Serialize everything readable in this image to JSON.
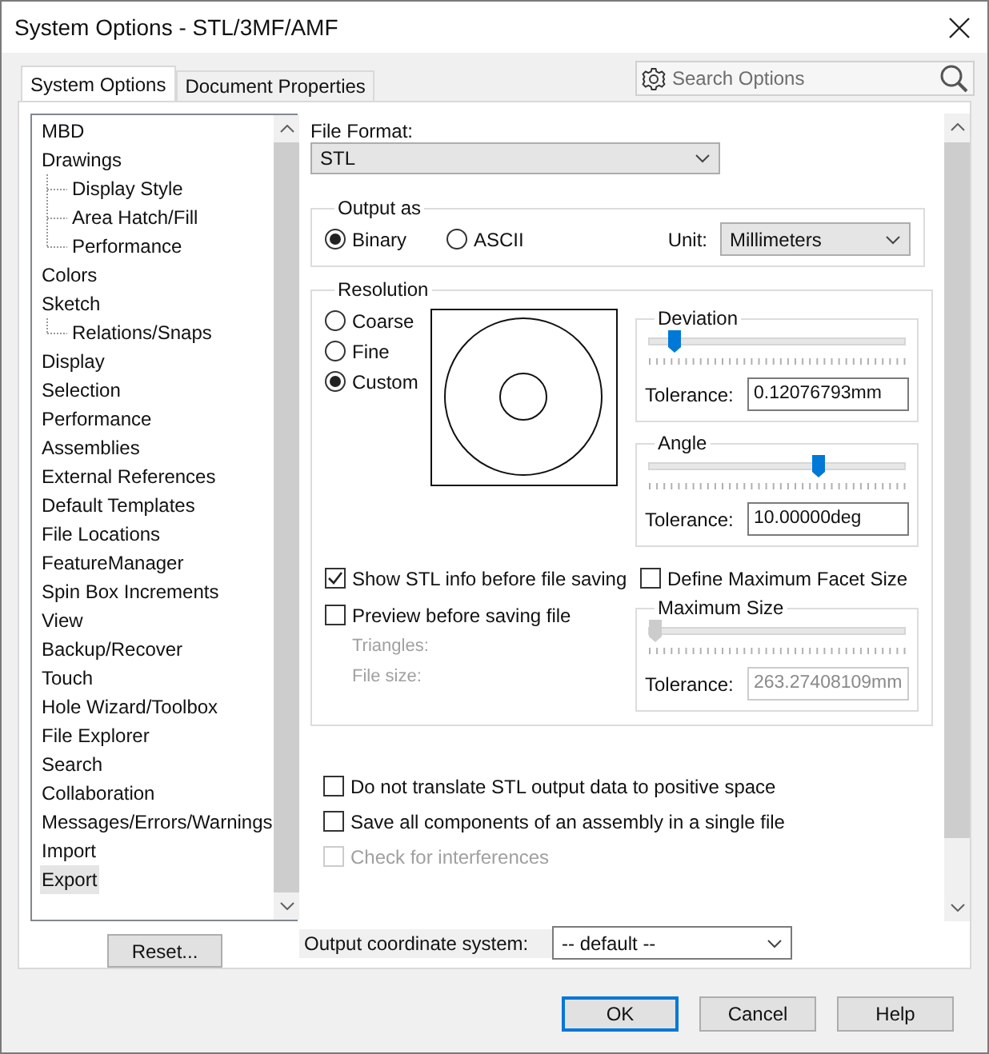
{
  "window": {
    "title": "System Options - STL/3MF/AMF"
  },
  "tabs": [
    {
      "label": "System Options",
      "selected": true
    },
    {
      "label": "Document Properties",
      "selected": false
    }
  ],
  "search": {
    "placeholder": "Search Options"
  },
  "tree": [
    {
      "label": "MBD",
      "selected": false
    },
    {
      "label": "Drawings",
      "selected": false,
      "children": [
        {
          "label": "Display Style",
          "selected": false
        },
        {
          "label": "Area Hatch/Fill",
          "selected": false
        },
        {
          "label": "Performance",
          "selected": false
        }
      ]
    },
    {
      "label": "Colors",
      "selected": false
    },
    {
      "label": "Sketch",
      "selected": false,
      "children": [
        {
          "label": "Relations/Snaps",
          "selected": false
        }
      ]
    },
    {
      "label": "Display",
      "selected": false
    },
    {
      "label": "Selection",
      "selected": false
    },
    {
      "label": "Performance",
      "selected": false
    },
    {
      "label": "Assemblies",
      "selected": false
    },
    {
      "label": "External References",
      "selected": false
    },
    {
      "label": "Default Templates",
      "selected": false
    },
    {
      "label": "File Locations",
      "selected": false
    },
    {
      "label": "FeatureManager",
      "selected": false
    },
    {
      "label": "Spin Box Increments",
      "selected": false
    },
    {
      "label": "View",
      "selected": false
    },
    {
      "label": "Backup/Recover",
      "selected": false
    },
    {
      "label": "Touch",
      "selected": false
    },
    {
      "label": "Hole Wizard/Toolbox",
      "selected": false
    },
    {
      "label": "File Explorer",
      "selected": false
    },
    {
      "label": "Search",
      "selected": false
    },
    {
      "label": "Collaboration",
      "selected": false
    },
    {
      "label": "Messages/Errors/Warnings",
      "selected": false
    },
    {
      "label": "Import",
      "selected": false
    },
    {
      "label": "Export",
      "selected": true
    }
  ],
  "reset_button": "Reset...",
  "file_format": {
    "label": "File Format:",
    "value": "STL"
  },
  "output_as": {
    "title": "Output as",
    "options": [
      {
        "label": "Binary",
        "selected": true
      },
      {
        "label": "ASCII",
        "selected": false
      }
    ],
    "unit_label": "Unit:",
    "unit": "Millimeters"
  },
  "resolution": {
    "title": "Resolution",
    "options": [
      {
        "label": "Coarse",
        "selected": false
      },
      {
        "label": "Fine",
        "selected": false
      },
      {
        "label": "Custom",
        "selected": true
      }
    ],
    "deviation": {
      "title": "Deviation",
      "level": 0.08,
      "tolerance_label": "Tolerance:",
      "tolerance": "0.12076793mm",
      "disabled": false
    },
    "angle": {
      "title": "Angle",
      "level": 0.67,
      "tolerance_label": "Tolerance:",
      "tolerance": "10.00000deg",
      "disabled": false
    },
    "show_info": {
      "label": "Show STL info before file saving",
      "checked": true,
      "disabled": false
    },
    "preview": {
      "label": "Preview before saving file",
      "checked": false,
      "disabled": false
    },
    "info_lines": [
      "Triangles:",
      "File size:"
    ],
    "define_max_facet": {
      "label": "Define Maximum Facet Size",
      "checked": false,
      "disabled": false
    },
    "maximum_size": {
      "title": "Maximum Size",
      "level": 0,
      "tolerance_label": "Tolerance:",
      "tolerance": "263.27408109mm",
      "disabled": true
    }
  },
  "options": [
    {
      "label": "Do not translate STL output data to positive space",
      "checked": false,
      "disabled": false
    },
    {
      "label": "Save all components of an assembly in a single file",
      "checked": false,
      "disabled": false
    },
    {
      "label": "Check for interferences",
      "checked": false,
      "disabled": true
    }
  ],
  "output_coordinate_system": {
    "label": "Output coordinate system:",
    "value": "-- default --"
  },
  "buttons": [
    {
      "label": "OK",
      "default": true
    },
    {
      "label": "Cancel",
      "default": false
    },
    {
      "label": "Help",
      "default": false
    }
  ]
}
